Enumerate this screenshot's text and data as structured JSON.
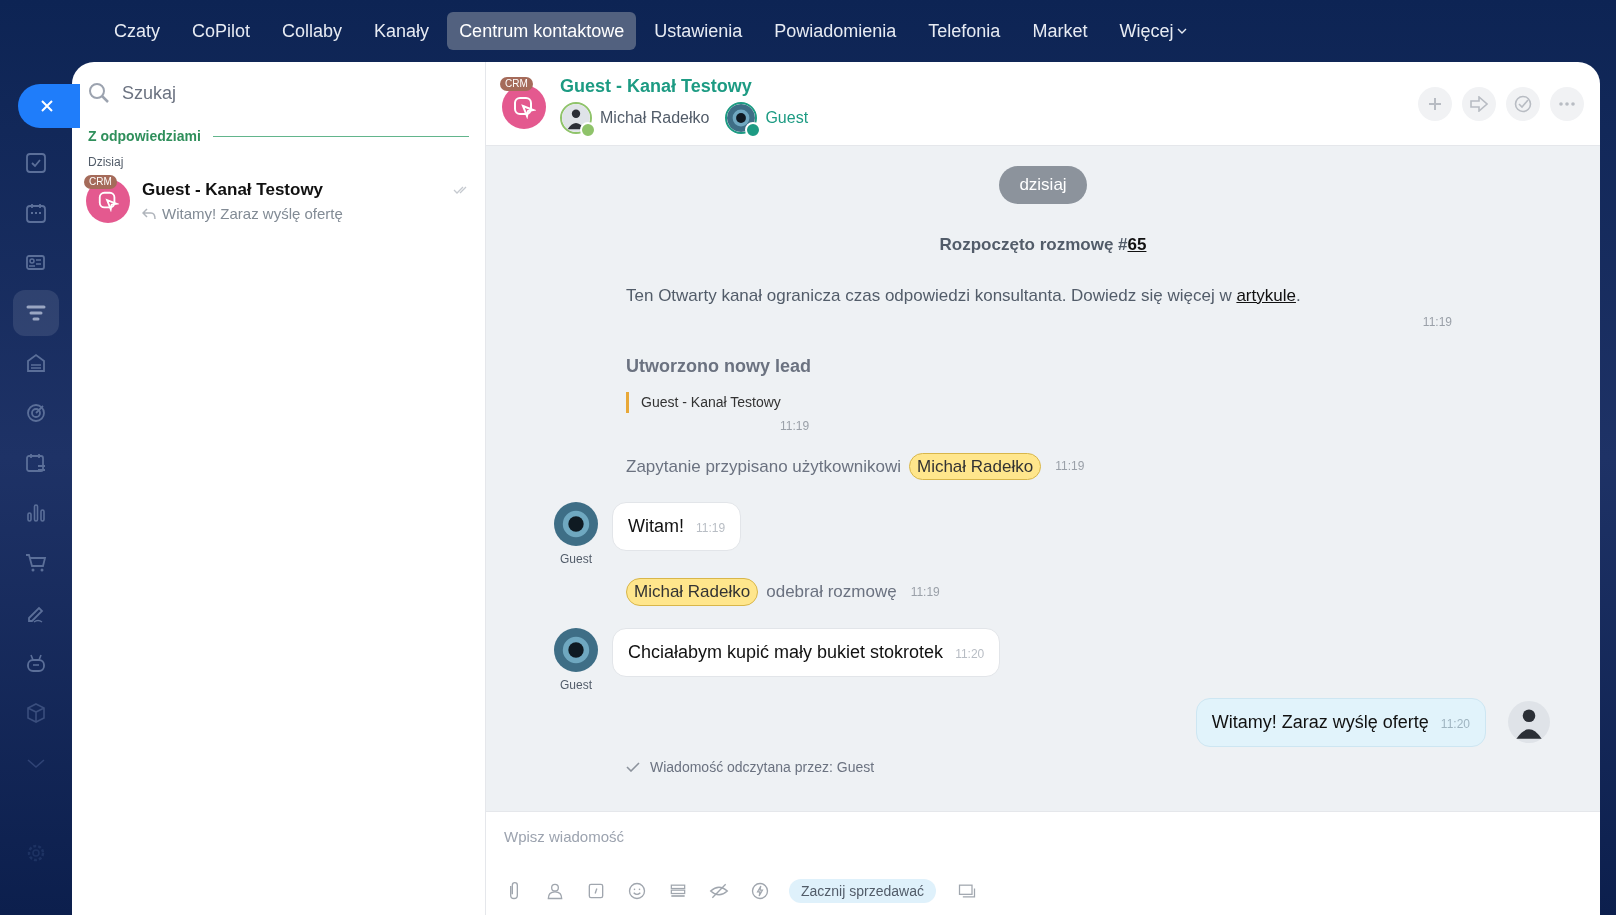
{
  "top_menu": [
    {
      "label": "Czaty",
      "selected": false
    },
    {
      "label": "CoPilot",
      "selected": false
    },
    {
      "label": "Collaby",
      "selected": false
    },
    {
      "label": "Kanały",
      "selected": false
    },
    {
      "label": "Centrum kontaktowe",
      "selected": true
    },
    {
      "label": "Ustawienia",
      "selected": false
    },
    {
      "label": "Powiadomienia",
      "selected": false
    },
    {
      "label": "Telefonia",
      "selected": false
    },
    {
      "label": "Market",
      "selected": false
    },
    {
      "label": "Więcej",
      "selected": false,
      "dropdown": true
    }
  ],
  "sidebar": {
    "items": [
      {
        "selected": false
      },
      {
        "selected": false
      },
      {
        "selected": false
      },
      {
        "selected": true
      },
      {
        "selected": false
      },
      {
        "selected": false
      },
      {
        "selected": false
      },
      {
        "selected": false
      },
      {
        "selected": false
      },
      {
        "selected": false
      },
      {
        "selected": false
      },
      {
        "selected": false
      },
      {
        "selected": false
      },
      {
        "selected": false
      }
    ]
  },
  "chat_list": {
    "search": {
      "placeholder": "Szukaj"
    },
    "section": "Z odpowiedziami",
    "group": "Dzisiaj",
    "items": [
      {
        "badge": "CRM",
        "title": "Guest - Kanał Testowy",
        "preview": "Witamy! Zaraz wyślę ofertę",
        "read": true
      }
    ]
  },
  "chat": {
    "badge": "CRM",
    "title": "Guest - Kanał Testowy",
    "members": [
      {
        "name": "Michał Radełko",
        "kind": "operator"
      },
      {
        "name": "Guest",
        "kind": "guest"
      }
    ],
    "messages": [
      {
        "kind": "date",
        "text": "dzisiaj"
      },
      {
        "kind": "start",
        "text": "Rozpoczęto rozmowę #",
        "link": "65"
      },
      {
        "kind": "notice",
        "text": "Ten Otwarty kanał ogranicza czas odpowiedzi konsultanta. Dowiedz się więcej w ",
        "link": "artykule",
        "suffix": ".",
        "time": "11:19"
      },
      {
        "kind": "lead",
        "title": "Utworzono nowy lead",
        "quote": "Guest - Kanał Testowy",
        "time": "11:19"
      },
      {
        "kind": "assign",
        "text": "Zapytanie przypisano użytkownikowi",
        "user": "Michał Radełko",
        "time": "11:19"
      },
      {
        "kind": "incoming",
        "author": "Guest",
        "text": "Witam!",
        "time": "11:19"
      },
      {
        "kind": "accepted",
        "user": "Michał Radełko",
        "text": "odebrał rozmowę",
        "time": "11:19"
      },
      {
        "kind": "incoming",
        "author": "Guest",
        "text": "Chciałabym kupić mały bukiet stokrotek",
        "time": "11:20"
      },
      {
        "kind": "outgoing",
        "text": "Witamy! Zaraz wyślę ofertę",
        "time": "11:20"
      },
      {
        "kind": "read",
        "text": "Wiadomość odczytana przez: Guest"
      }
    ],
    "input": {
      "placeholder": "Wpisz wiadomość"
    },
    "sell_button": "Zacznij sprzedawać"
  }
}
